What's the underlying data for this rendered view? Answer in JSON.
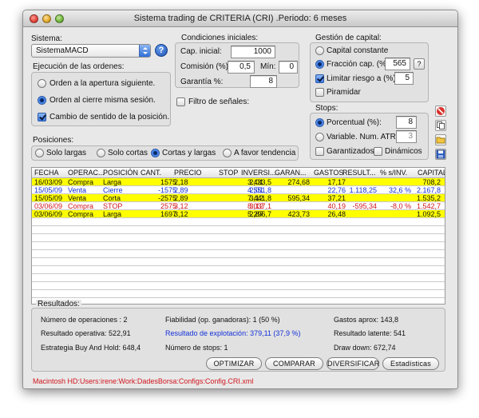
{
  "window": {
    "title": "Sistema trading de CRITERIA (CRI) .Periodo: 6 meses"
  },
  "colors": {
    "yellow_row": "#ffff00",
    "blue_text": "#1330d8",
    "red_text": "#d0161e",
    "radio_on": "#3d7de8"
  },
  "sistema": {
    "label": "Sistema:",
    "selected": "SistemaMACD",
    "help_icon": "question-icon"
  },
  "ejecucion": {
    "label": "Ejecución de las ordenes:",
    "opt1": "Orden a la apertura siguiente.",
    "opt2": "Orden al cierre misma sesión.",
    "check": "Cambio de sentido de la posición.",
    "selected": "opt2"
  },
  "condiciones": {
    "label": "Condiciones iniciales:",
    "cap_label": "Cap. inicial:",
    "cap_value": "1000",
    "com_label": "Comisión (%):",
    "com_value": "0,5",
    "min_label": "Mín:",
    "min_value": "0",
    "gar_label": "Garantía %:",
    "gar_value": "8",
    "filtro_label": "Filtro de señales:"
  },
  "gestion": {
    "label": "Gestión de capital:",
    "capital_constante": "Capital constante",
    "fraccion_label": "Fracción cap. (%):",
    "fraccion_value": "565",
    "fraccion_btn": "?",
    "limitar_label": "Limitar riesgo a (%):",
    "limitar_value": "5",
    "piramidar": "Piramidar"
  },
  "stops": {
    "label": "Stops:",
    "porcentual_label": "Porcentual (%):",
    "porcentual_value": "8",
    "variable_label": "Variable. Num. ATR:",
    "variable_value": "3",
    "garantizados": "Garantizados",
    "dinamicos": "Dinámicos"
  },
  "posiciones": {
    "label": "Posiciones:",
    "opt1": "Solo largas",
    "opt2": "Solo cortas",
    "opt3": "Cortas y largas",
    "opt4": "A favor tendencia",
    "selected": "opt3"
  },
  "table": {
    "headers": [
      "FECHA",
      "OPERAC...",
      "POSICIÓN",
      "CANT.",
      "PRECIO",
      "STOP",
      "INVERSI...",
      "GARAN...",
      "GASTOS",
      "RESULT...",
      "% s/INV.",
      "CAPITAL"
    ],
    "rows": [
      {
        "style": "yellow",
        "cells": [
          "16/03/09",
          "Compra",
          "Larga",
          "1575",
          "2,18",
          "2,01",
          "3.433,5",
          "274,68",
          "17,17",
          "",
          "",
          "708,2"
        ]
      },
      {
        "style": "blue",
        "cells": [
          "15/05/09",
          "Venta",
          "Cierre",
          "-1575",
          "2,89",
          "2,01",
          "4.551,8",
          "",
          "22,76",
          "1.118,25",
          "32,6 %",
          "2.167,8"
        ]
      },
      {
        "style": "yellow",
        "cells": [
          "15/05/09",
          "Venta",
          "Corta",
          "-2575",
          "2,89",
          "3,12",
          "7.441,8",
          "595,34",
          "37,21",
          "",
          "",
          "1.535,2"
        ]
      },
      {
        "style": "red",
        "cells": [
          "03/06/09",
          "Compra",
          "STOP",
          "2575",
          "3,12",
          "3,12",
          "8.037,1",
          "",
          "40,19",
          "-595,34",
          "-8,0 %",
          "1.542,7"
        ]
      },
      {
        "style": "yellow",
        "cells": [
          "03/06/09",
          "Compra",
          "Larga",
          "1697",
          "3,12",
          "2,87",
          "5.296,7",
          "423,73",
          "26,48",
          "",
          "",
          "1.092,5"
        ]
      }
    ]
  },
  "resultados": {
    "label": "Resultados:",
    "num_ops": "Número de operaciones : 2",
    "fiabilidad": "Fiabilidad (op. ganadoras): 1 (50 %)",
    "gastos": "Gastos aprox: 143,8",
    "res_operativa": "Resultado operativa: 522,91",
    "res_explotacion": "Resultado de explotación: 379,11 (37,9 %)",
    "res_latente": "Resultado latente: 541",
    "buy_hold": "Estrategia Buy And Hold: 648,4",
    "num_stops": "Número de stops: 1",
    "drawdown": "Draw down: 672,74"
  },
  "buttons": {
    "optimizar": "OPTIMIZAR",
    "comparar": "COMPARAR",
    "diversificar": "DIVERSIFICAR",
    "estadisticas": "Estadísticas"
  },
  "toolbar_icons": [
    "stop-icon",
    "copy-icon",
    "folder-icon",
    "save-icon"
  ],
  "file_path": "Macintosh HD:Users:irene:Work:DadesBorsa:Configs:Config.CRI.xml"
}
